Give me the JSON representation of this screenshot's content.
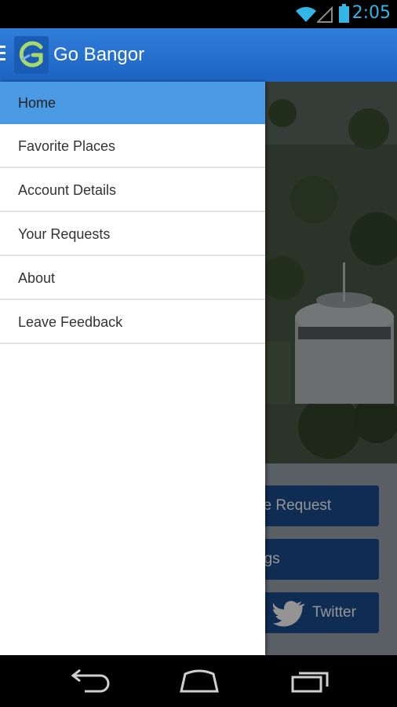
{
  "status_bar": {
    "time": "2:05"
  },
  "app_bar": {
    "title": "Go Bangor"
  },
  "drawer": {
    "items": [
      {
        "label": "Home",
        "active": true
      },
      {
        "label": "Favorite Places",
        "active": false
      },
      {
        "label": "Account Details",
        "active": false
      },
      {
        "label": "Your Requests",
        "active": false
      },
      {
        "label": "About",
        "active": false
      },
      {
        "label": "Leave Feedback",
        "active": false
      }
    ]
  },
  "content": {
    "buttons": {
      "service_request": "rvice Request",
      "meetings": "etings",
      "twitter": "Twitter"
    }
  },
  "colors": {
    "app_bar": "#1d63c2",
    "drawer_active": "#4a9be3",
    "button": "#1b4f8f",
    "clock": "#33b5e5"
  },
  "icons": [
    "wifi-icon",
    "signal-icon",
    "battery-icon",
    "drawer-indicator-icon",
    "go-bangor-logo",
    "twitter-bird-icon",
    "back-icon",
    "home-icon",
    "recent-apps-icon"
  ]
}
